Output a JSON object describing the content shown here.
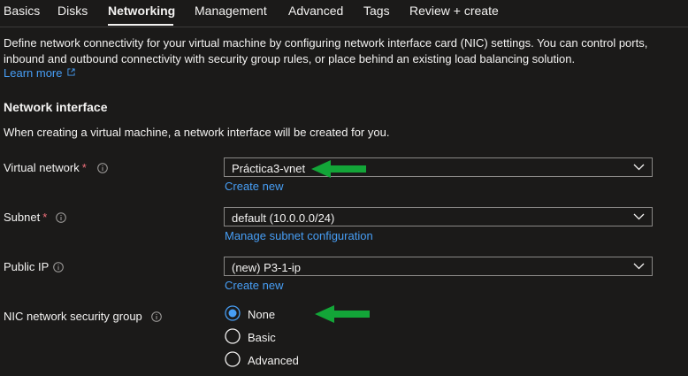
{
  "tabs": [
    {
      "label": "Basics"
    },
    {
      "label": "Disks"
    },
    {
      "label": "Networking"
    },
    {
      "label": "Management"
    },
    {
      "label": "Advanced"
    },
    {
      "label": "Tags"
    },
    {
      "label": "Review + create"
    }
  ],
  "active_tab": "Networking",
  "intro": {
    "description": "Define network connectivity for your virtual machine by configuring network interface card (NIC) settings. You can control ports, inbound and outbound connectivity with security group rules, or place behind an existing load balancing solution.",
    "learn_more": "Learn more"
  },
  "network_interface": {
    "title": "Network interface",
    "description": "When creating a virtual machine, a network interface will be created for you."
  },
  "fields": {
    "virtual_network": {
      "label": "Virtual network",
      "required_mark": "*",
      "value": "Práctica3-vnet",
      "link": "Create new"
    },
    "subnet": {
      "label": "Subnet",
      "required_mark": "*",
      "value": "default (10.0.0.0/24)",
      "link": "Manage subnet configuration"
    },
    "public_ip": {
      "label": "Public IP",
      "value": "(new) P3-1-ip",
      "link": "Create new"
    },
    "nic_nsg": {
      "label": "NIC network security group",
      "options": [
        {
          "label": "None",
          "selected": true
        },
        {
          "label": "Basic",
          "selected": false
        },
        {
          "label": "Advanced",
          "selected": false
        }
      ]
    }
  },
  "colors": {
    "background": "#1b1a19",
    "text": "#f3f2f1",
    "link": "#479ef5",
    "required": "#f1707b",
    "radio_selected": "#479ef5",
    "annotation_arrow": "#13a538"
  },
  "icons": [
    "info-icon",
    "chevron-down-icon",
    "external-link-icon",
    "green-arrow-annotation"
  ]
}
